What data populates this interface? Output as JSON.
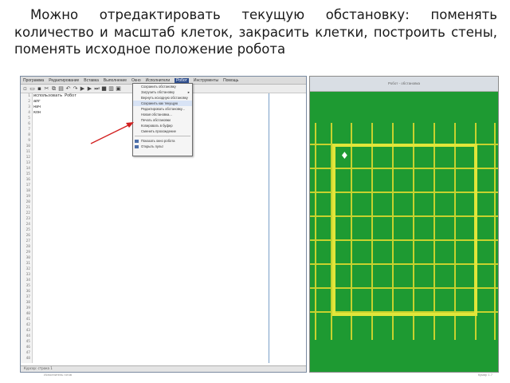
{
  "caption": "Можно отредактировать текущую обстановку: поменять количество и масштаб клеток, закрасить клетки, построить стены, поменять исходное положение робота",
  "ide": {
    "menu": [
      "Программа",
      "Редактирование",
      "Вставка",
      "Выполнение",
      "Окно",
      "Исполнители",
      "Робот",
      "Инструменты",
      "Помощь"
    ],
    "active_menu_index": 6,
    "toolbar_icons": [
      "new-file",
      "open-folder",
      "save",
      "cut",
      "copy",
      "paste",
      "undo",
      "redo",
      "run",
      "step",
      "step-into",
      "stop",
      "clear",
      "robot"
    ],
    "line_numbers": [
      "1",
      "2",
      "3",
      "4",
      "5",
      "6",
      "7",
      "8",
      "9",
      "10",
      "11",
      "12",
      "13",
      "14",
      "15",
      "16",
      "17",
      "18",
      "19",
      "20",
      "21",
      "22",
      "23",
      "24",
      "25",
      "26",
      "27",
      "28",
      "29",
      "30",
      "31",
      "32",
      "33",
      "34",
      "35",
      "36",
      "37",
      "38",
      "39",
      "40",
      "41",
      "42",
      "43",
      "44",
      "45",
      "46",
      "47",
      "48"
    ],
    "code": [
      "использовать Робот",
      "алг",
      "нач",
      "",
      "кон"
    ],
    "status": "Курсор: строка 1"
  },
  "dropdown": {
    "items": [
      {
        "label": "Сохранить обстановку"
      },
      {
        "label": "Загрузить обстановку",
        "submenu": true
      },
      {
        "label": "Вернуть исходную обстановку"
      },
      {
        "label": "Сохранить как текущую",
        "selected": true
      },
      {
        "label": "Редактировать обстановку..."
      },
      {
        "label": "Новая обстановка..."
      },
      {
        "label": "Печать обстановки"
      },
      {
        "label": "Копировать в буфер"
      },
      {
        "label": "Сменить прохождение"
      }
    ],
    "extra": [
      {
        "label": "Показать окно робота"
      },
      {
        "label": "Открыть пульт"
      }
    ]
  },
  "robot_window": {
    "title": "Робот - обстановка"
  },
  "taskbar": {
    "left": "Исполнитель готов",
    "right": "Кумир 1.7"
  }
}
